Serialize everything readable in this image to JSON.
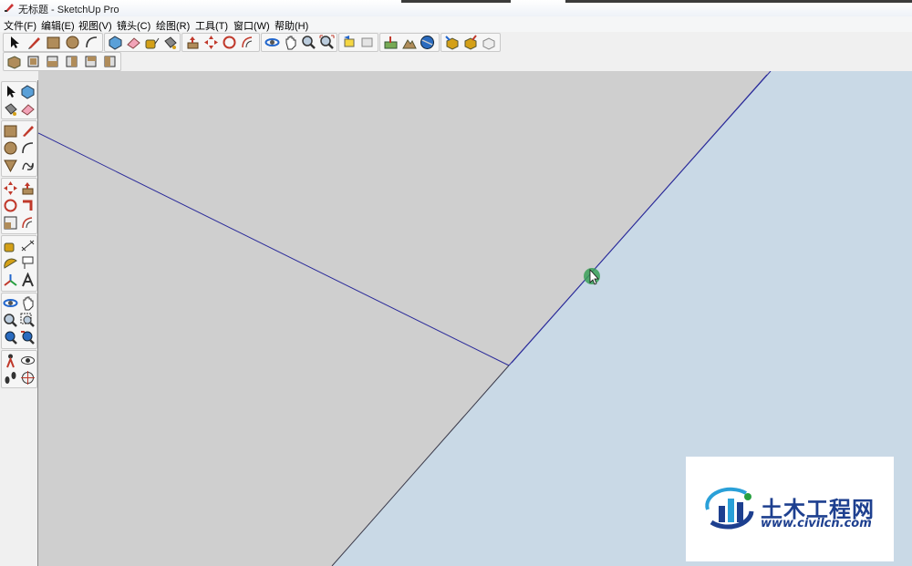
{
  "window": {
    "title": "无标题 - SketchUp Pro"
  },
  "menu": {
    "items": [
      "文件(F)",
      "编辑(E)",
      "视图(V)",
      "镜头(C)",
      "绘图(R)",
      "工具(T)",
      "窗口(W)",
      "帮助(H)"
    ]
  },
  "toolbar_top": {
    "tools": [
      "select-tool",
      "line-tool",
      "rectangle-tool",
      "circle-tool",
      "arc-tool",
      "make-component-tool",
      "eraser-tool",
      "tape-measure-tool",
      "paint-bucket-tool",
      "push-pull-tool",
      "move-tool",
      "rotate-tool",
      "offset-tool",
      "orbit-tool",
      "pan-tool",
      "zoom-tool",
      "zoom-extents-tool",
      "previous-view-tool",
      "next-view-tool",
      "add-location-tool",
      "toggle-terrain-tool",
      "get-models-tool",
      "share-model-tool",
      "share-component-tool",
      "extension-warehouse-tool"
    ],
    "views": [
      "iso-view",
      "top-view",
      "front-view",
      "right-view",
      "back-view",
      "left-view"
    ]
  },
  "toolbar_left": {
    "tools": [
      "select-tool",
      "make-component-tool",
      "paint-bucket-tool",
      "eraser-tool",
      "rectangle-tool",
      "line-tool",
      "circle-tool",
      "arc-tool",
      "polygon-tool",
      "freehand-tool",
      "move-tool",
      "push-pull-tool",
      "rotate-tool",
      "follow-me-tool",
      "scale-tool",
      "offset-tool",
      "tape-measure-tool",
      "dimension-tool",
      "protractor-tool",
      "text-tool",
      "axes-tool",
      "3d-text-tool",
      "orbit-tool",
      "pan-tool",
      "zoom-tool",
      "zoom-window-tool",
      "zoom-extents-tool",
      "previous-view-tool",
      "position-camera-tool",
      "look-around-tool",
      "walk-tool",
      "section-plane-tool"
    ]
  },
  "watermark": {
    "name": "土木工程网",
    "url": "www.civilcn.com"
  },
  "colors": {
    "ground": "#cfcfcf",
    "sky": "#c9d9e6",
    "edge_blue": "#2b2b9a",
    "brand": "#1d3f8f",
    "cursor_ring": "#39a057"
  }
}
